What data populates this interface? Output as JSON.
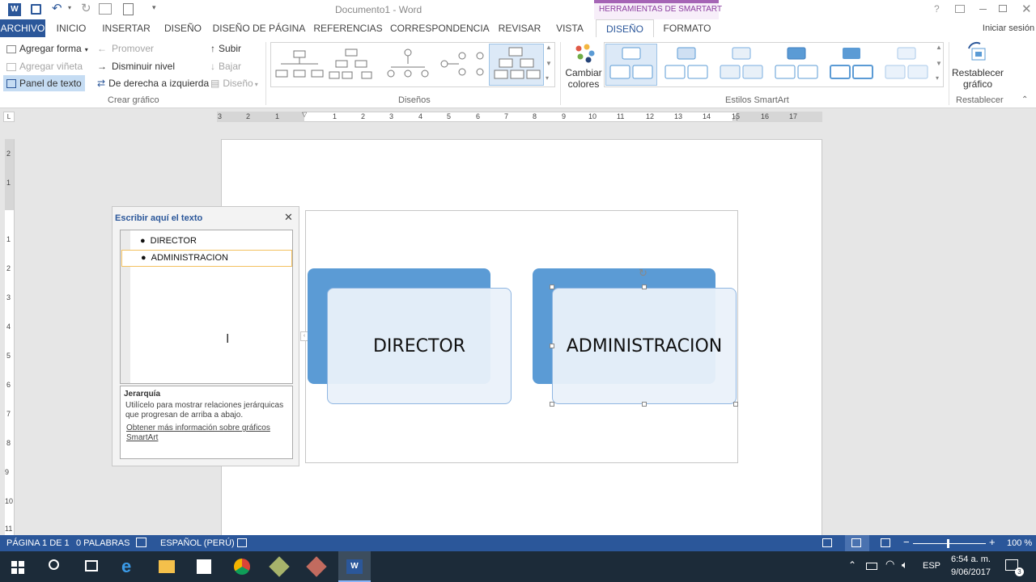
{
  "app": {
    "title": "Documento1 - Word",
    "tools_context": "HERRAMIENTAS DE SMARTART",
    "signin": "Iniciar sesión",
    "help": "?"
  },
  "tabs": [
    "ARCHIVO",
    "INICIO",
    "INSERTAR",
    "DISEÑO",
    "DISEÑO DE PÁGINA",
    "REFERENCIAS",
    "CORRESPONDENCIA",
    "REVISAR",
    "VISTA",
    "DISEÑO",
    "FORMATO"
  ],
  "ribbon": {
    "crear": {
      "agregar_forma": "Agregar forma",
      "agregar_vineta": "Agregar viñeta",
      "panel_texto": "Panel de texto",
      "promover": "Promover",
      "disminuir": "Disminuir nivel",
      "derecha_izq": "De derecha a izquierda",
      "subir": "Subir",
      "bajar": "Bajar",
      "diseno": "Diseño",
      "label": "Crear gráfico"
    },
    "disenos_label": "Diseños",
    "cambiar_colores_1": "Cambiar",
    "cambiar_colores_2": "colores",
    "estilos_label": "Estilos SmartArt",
    "restablecer_1": "Restablecer",
    "restablecer_2": "gráfico",
    "restablecer_label": "Restablecer"
  },
  "ruler": [
    "3",
    "2",
    "1",
    "1",
    "2",
    "3",
    "4",
    "5",
    "6",
    "7",
    "8",
    "9",
    "10",
    "11",
    "12",
    "13",
    "14",
    "15",
    "16",
    "17"
  ],
  "vruler": [
    "2",
    "1",
    "1",
    "2",
    "3",
    "4",
    "5",
    "6",
    "7",
    "8",
    "9",
    "10",
    "11"
  ],
  "textpane": {
    "title": "Escribir aquí el texto",
    "items": [
      "DIRECTOR",
      "ADMINISTRACION"
    ],
    "info_title": "Jerarquía",
    "info_desc": "Utilícelo para mostrar relaciones jerárquicas que progresan de arriba a abajo.",
    "info_link": "Obtener más información sobre gráficos SmartArt"
  },
  "smartart": {
    "box1": "DIRECTOR",
    "box2": "ADMINISTRACION",
    "accent": "#5b9bd5"
  },
  "status": {
    "page": "PÁGINA 1 DE 1",
    "words": "0 PALABRAS",
    "lang": "ESPAÑOL (PERÚ)",
    "zoom": "100 %"
  },
  "taskbar": {
    "lang": "ESP",
    "time": "6:54 a. m.",
    "date": "9/06/2017",
    "notif": "3"
  }
}
